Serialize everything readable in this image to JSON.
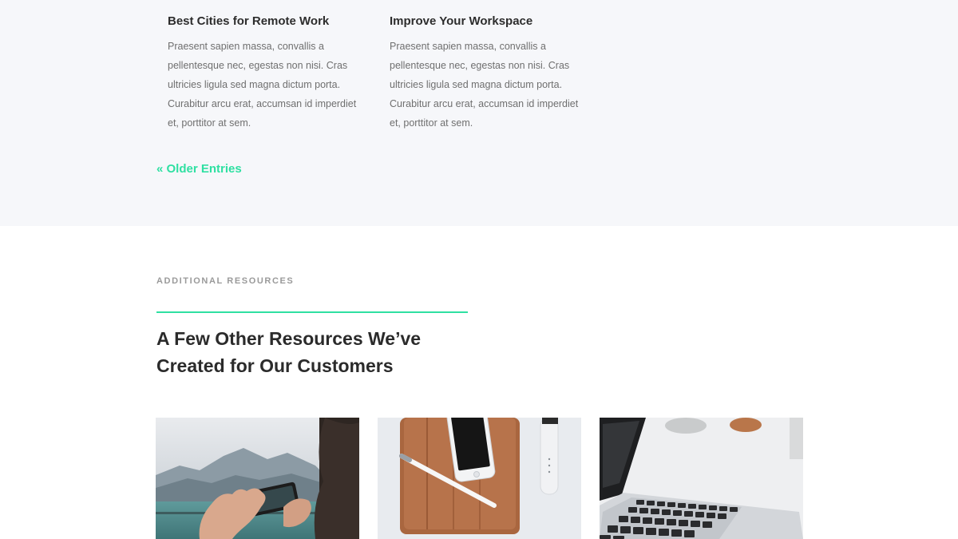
{
  "posts": [
    {
      "title": "Best Cities for Remote Work",
      "excerpt": "Praesent sapien massa, convallis a pellentesque nec, egestas non nisi. Cras ultricies ligula sed magna dictum porta. Curabitur arcu erat, accumsan id imperdiet et, porttitor at sem."
    },
    {
      "title": "Improve Your Workspace",
      "excerpt": "Praesent sapien massa, convallis a pellentesque nec, egestas non nisi. Cras ultricies ligula sed magna dictum porta. Curabitur arcu erat, accumsan id imperdiet et, porttitor at sem."
    }
  ],
  "pagination": {
    "older_entries": "« Older Entries"
  },
  "resources": {
    "eyebrow": "ADDITIONAL RESOURCES",
    "heading": "A Few Other Resources We’ve Created for Our Customers",
    "cards": [
      {
        "image": "photo-hands-smartphone-mountains"
      },
      {
        "image": "photo-phone-tablet-stylus-watch"
      },
      {
        "image": "photo-laptop-keyboard"
      }
    ]
  },
  "colors": {
    "accent": "#2fe0a2",
    "blog_background": "#f6f7fa",
    "heading": "#2b2b2b",
    "body_text": "#6f6f6f",
    "eyebrow": "#9a9a9a"
  }
}
